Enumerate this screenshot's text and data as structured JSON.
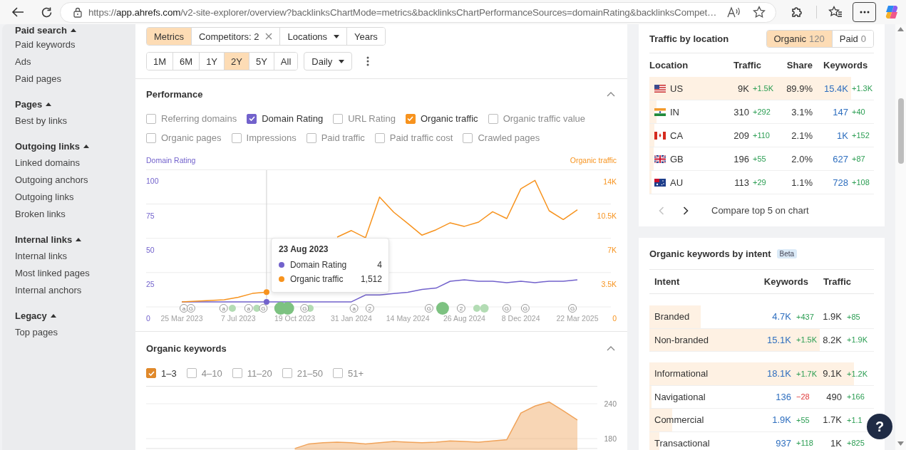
{
  "browser": {
    "url_scheme": "https://",
    "url_host": "app.ahrefs.com",
    "url_rest": "/v2-site-explorer/overview?backlinksChartMode=metrics&backlinksChartPerformanceSources=domainRating&backlinksCompet…"
  },
  "sidebar": [
    {
      "title": "Paid search",
      "expanded": true,
      "items": [
        "Paid keywords",
        "Ads",
        "Paid pages"
      ]
    },
    {
      "title": "Pages",
      "expanded": true,
      "items": [
        "Best by links"
      ]
    },
    {
      "title": "Outgoing links",
      "expanded": true,
      "items": [
        "Linked domains",
        "Outgoing anchors",
        "Outgoing links",
        "Broken links"
      ]
    },
    {
      "title": "Internal links",
      "expanded": true,
      "items": [
        "Internal links",
        "Most linked pages",
        "Internal anchors"
      ]
    },
    {
      "title": "Legacy",
      "expanded": true,
      "items": [
        "Top pages"
      ]
    }
  ],
  "toolbar": {
    "modes": [
      {
        "label": "Metrics",
        "selected": true,
        "kind": "plain"
      },
      {
        "label": "Competitors: 2",
        "selected": false,
        "kind": "clearable"
      },
      {
        "label": "Locations",
        "selected": false,
        "kind": "dropdown"
      },
      {
        "label": "Years",
        "selected": false,
        "kind": "plain"
      }
    ],
    "ranges": [
      {
        "label": "1M",
        "selected": false
      },
      {
        "label": "6M",
        "selected": false
      },
      {
        "label": "1Y",
        "selected": false
      },
      {
        "label": "2Y",
        "selected": true
      },
      {
        "label": "5Y",
        "selected": false
      },
      {
        "label": "All",
        "selected": false
      }
    ],
    "interval": "Daily"
  },
  "performance": {
    "title": "Performance",
    "expanded": true,
    "metrics": [
      {
        "label": "Referring domains",
        "checked": false
      },
      {
        "label": "Domain Rating",
        "checked": true,
        "color": "#7262cc"
      },
      {
        "label": "URL Rating",
        "checked": false
      },
      {
        "label": "Organic traffic",
        "checked": true,
        "color": "#f7931e"
      },
      {
        "label": "Organic traffic value",
        "checked": false
      },
      {
        "label": "Organic pages",
        "checked": false
      },
      {
        "label": "Impressions",
        "checked": false
      },
      {
        "label": "Paid traffic",
        "checked": false
      },
      {
        "label": "Paid traffic cost",
        "checked": false
      },
      {
        "label": "Crawled pages",
        "checked": false
      }
    ],
    "tooltip": {
      "date": "23 Aug 2023",
      "rows": [
        {
          "label": "Domain Rating",
          "value": "4",
          "color": "#7262cc"
        },
        {
          "label": "Organic traffic",
          "value": "1,512",
          "color": "#f7931e"
        }
      ]
    },
    "chart_data": {
      "type": "line",
      "ylabel": "Domain Rating",
      "y2label": "Organic traffic",
      "categories": [
        "25 Mar 2023",
        null,
        null,
        null,
        "7 Jul 2023",
        null,
        null,
        null,
        "19 Oct 2023",
        null,
        null,
        null,
        "31 Jan 2024",
        null,
        null,
        null,
        "14 May 2024",
        null,
        null,
        null,
        "26 Aug 2024",
        null,
        null,
        null,
        "8 Dec 2024",
        null,
        null,
        null,
        "22 Mar 2025"
      ],
      "series": [
        {
          "color": "#7262cc",
          "values": [
            12,
            12,
            12,
            12,
            12,
            12,
            12,
            12,
            12,
            12,
            12,
            12,
            12,
            17,
            17,
            18,
            19,
            21,
            22,
            27,
            28,
            27,
            27,
            26,
            27,
            26,
            27,
            27,
            28
          ]
        },
        {
          "color": "#f7931e",
          "axis": "y2",
          "values": [
            1680,
            1750,
            1820,
            1890,
            2150,
            2540,
            2680,
            null,
            null,
            null,
            null,
            8300,
            8970,
            8240,
            12400,
            10850,
            9700,
            8500,
            9050,
            9770,
            9400,
            9830,
            10900,
            10200,
            13250,
            14100,
            11000,
            10100,
            11090
          ]
        }
      ],
      "ylim": [
        0,
        108
      ],
      "yticks": [
        0,
        25,
        50,
        75,
        100
      ],
      "y2lim": [
        0,
        15150
      ],
      "y2ticks": [
        {
          "value": 0,
          "label": "0"
        },
        {
          "value": 3500,
          "label": "3.5K"
        },
        {
          "value": 7000,
          "label": "7K"
        },
        {
          "value": 10500,
          "label": "10.5K"
        },
        {
          "value": 14000,
          "label": "14K"
        }
      ]
    },
    "events": [
      {
        "text": "a"
      },
      {
        "text": "G"
      },
      {
        "text": "a"
      },
      {
        "text": "a"
      },
      {
        "text": "G"
      },
      {
        "text": "G"
      },
      {
        "text": "a"
      },
      {
        "text": "2"
      },
      {
        "text": "G"
      },
      {
        "text": "2"
      },
      {
        "text": "G"
      },
      {
        "text": "G"
      },
      {
        "text": "G"
      }
    ]
  },
  "organic_keywords": {
    "title": "Organic keywords",
    "expanded": true,
    "positions": [
      {
        "label": "1–3",
        "checked": true,
        "color": "#e0892b"
      },
      {
        "label": "4–10",
        "checked": false
      },
      {
        "label": "11–20",
        "checked": false
      },
      {
        "label": "21–50",
        "checked": false
      },
      {
        "label": "51+",
        "checked": false
      }
    ],
    "chart_data": {
      "type": "area",
      "categories": [
        null,
        null,
        null,
        null,
        null,
        null,
        null,
        null,
        null,
        null,
        null,
        null,
        null,
        null,
        null,
        null,
        null,
        null,
        null,
        null,
        null,
        null,
        null,
        null,
        null,
        null,
        null,
        null,
        null
      ],
      "series": [
        {
          "color": "#f0a35a",
          "values": [
            null,
            null,
            null,
            null,
            null,
            null,
            null,
            null,
            163,
            171,
            173,
            174,
            173,
            171,
            173,
            175,
            174,
            173,
            174,
            176,
            175,
            174,
            176,
            178,
            224,
            236,
            243,
            228,
            212
          ]
        }
      ],
      "ylim": [
        163,
        270
      ],
      "yticks": [
        180,
        240
      ]
    }
  },
  "traffic_by_location": {
    "title": "Traffic by location",
    "tabs": [
      {
        "label": "Organic",
        "count": "120",
        "selected": true
      },
      {
        "label": "Paid",
        "count": "0",
        "selected": false
      }
    ],
    "columns": [
      "Location",
      "Traffic",
      "Share",
      "Keywords"
    ],
    "rows": [
      {
        "kind": "us",
        "code": "US",
        "traffic": "9K",
        "traffic_change": "+1.5K",
        "share": "89.9%",
        "keywords": "15.4K",
        "keywords_change": "+1.3K",
        "level": 0.899
      },
      {
        "kind": "in",
        "code": "IN",
        "traffic": "310",
        "traffic_change": "+292",
        "share": "3.1%",
        "keywords": "147",
        "keywords_change": "+40",
        "level": 0.031
      },
      {
        "kind": "ca",
        "code": "CA",
        "traffic": "209",
        "traffic_change": "+110",
        "share": "2.1%",
        "keywords": "1K",
        "keywords_change": "+152",
        "level": 0.021
      },
      {
        "kind": "gb",
        "code": "GB",
        "traffic": "196",
        "traffic_change": "+55",
        "share": "2.0%",
        "keywords": "627",
        "keywords_change": "+87",
        "level": 0.02
      },
      {
        "kind": "au",
        "code": "AU",
        "traffic": "113",
        "traffic_change": "+29",
        "share": "1.1%",
        "keywords": "728",
        "keywords_change": "+108",
        "level": 0.011
      }
    ],
    "pager": {
      "prev_disabled": true,
      "next_disabled": false,
      "label": "Compare top 5 on chart"
    }
  },
  "keywords_by_intent": {
    "title": "Organic keywords by intent",
    "badge": "Beta",
    "columns": [
      "Intent",
      "Keywords",
      "Traffic"
    ],
    "groups": [
      [
        {
          "name": "Branded",
          "keywords": "4.7K",
          "keywords_change": "+437",
          "keywords_negative": false,
          "traffic": "1.9K",
          "traffic_change": "+85",
          "traffic_negative": false,
          "level": 0.23
        },
        {
          "name": "Non-branded",
          "keywords": "15.1K",
          "keywords_change": "+1.5K",
          "keywords_negative": false,
          "traffic": "8.2K",
          "traffic_change": "+1.9K",
          "traffic_negative": false,
          "level": 0.76
        }
      ],
      [
        {
          "name": "Informational",
          "keywords": "18.1K",
          "keywords_change": "+1.7K",
          "keywords_negative": false,
          "traffic": "9.1K",
          "traffic_change": "+1.2K",
          "traffic_negative": false,
          "level": 0.91
        },
        {
          "name": "Navigational",
          "keywords": "136",
          "keywords_change": "−28",
          "keywords_negative": true,
          "traffic": "490",
          "traffic_change": "+166",
          "traffic_negative": false,
          "level": 0.01
        },
        {
          "name": "Commercial",
          "keywords": "1.9K",
          "keywords_change": "+55",
          "keywords_negative": false,
          "traffic": "1.7K",
          "traffic_change": "+1.1",
          "traffic_negative": false,
          "level": 0.1
        },
        {
          "name": "Transactional",
          "keywords": "937",
          "keywords_change": "+118",
          "keywords_negative": false,
          "traffic": "1K",
          "traffic_change": "+825",
          "traffic_negative": false,
          "level": 0.045
        }
      ]
    ]
  },
  "help": {
    "label": "?"
  }
}
